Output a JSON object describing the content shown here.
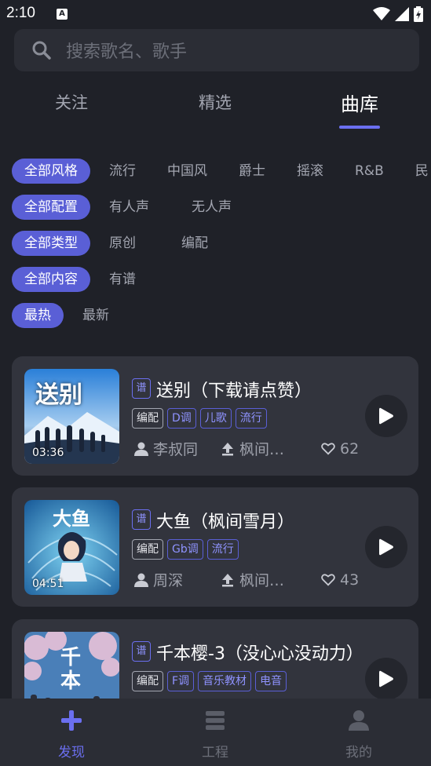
{
  "status_bar": {
    "time": "2:10",
    "notification_letter": "A"
  },
  "search": {
    "placeholder": "搜索歌名、歌手"
  },
  "tabs": [
    {
      "label": "关注"
    },
    {
      "label": "精选"
    },
    {
      "label": "曲库"
    }
  ],
  "active_tab": "曲库",
  "filters": [
    {
      "options": [
        "全部风格",
        "流行",
        "中国风",
        "爵士",
        "摇滚",
        "R&B",
        "民"
      ],
      "selected": "全部风格"
    },
    {
      "options": [
        "全部配置",
        "有人声",
        "无人声"
      ],
      "selected": "全部配置"
    },
    {
      "options": [
        "全部类型",
        "原创",
        "编配"
      ],
      "selected": "全部类型"
    },
    {
      "options": [
        "全部内容",
        "有谱"
      ],
      "selected": "全部内容"
    },
    {
      "options": [
        "最热",
        "最新"
      ],
      "selected": "最热"
    }
  ],
  "songs": [
    {
      "badge": "谱",
      "title": "送别（下载请点赞）",
      "tags": [
        "编配",
        "D调",
        "儿歌",
        "流行"
      ],
      "author": "李叔同",
      "uploader": "枫间…",
      "likes": "62",
      "duration": "03:36",
      "cover_text": "送别"
    },
    {
      "badge": "谱",
      "title": "大鱼（枫间雪月）",
      "tags": [
        "编配",
        "Gb调",
        "流行"
      ],
      "author": "周深",
      "uploader": "枫间…",
      "likes": "43",
      "duration": "04:51",
      "cover_text": "大鱼"
    },
    {
      "badge": "谱",
      "title": "千本樱-3（没心心没动力）",
      "tags": [
        "编配",
        "F调",
        "音乐教材",
        "电音"
      ],
      "author": "",
      "uploader": "",
      "likes": "",
      "duration": "",
      "cover_text": "千本"
    }
  ],
  "bottom_nav": [
    {
      "label": "发现",
      "icon": "plus-icon"
    },
    {
      "label": "工程",
      "icon": "stack-icon"
    },
    {
      "label": "我的",
      "icon": "person-icon"
    }
  ],
  "colors": {
    "accent": "#5a5fd6",
    "background": "#1f2128",
    "card": "#32343d"
  }
}
